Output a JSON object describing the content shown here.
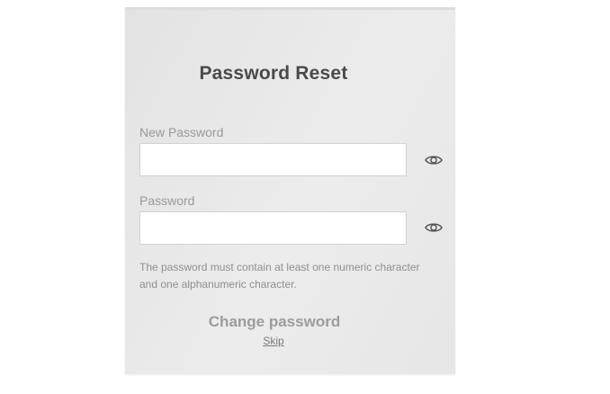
{
  "form": {
    "title": "Password Reset",
    "new_password_label": "New Password",
    "new_password_value": "",
    "password_label": "Password",
    "password_value": "",
    "hint": "The password must contain at least one numeric character and one alphanumeric character.",
    "submit_label": "Change password",
    "skip_label": "Skip"
  },
  "icons": {
    "toggle_visibility": "eye-icon"
  },
  "colors": {
    "card_background": "#e8e8e8",
    "title_text": "#4a4a4a",
    "muted_text": "#9a9a9a",
    "field_background": "#ffffff"
  }
}
